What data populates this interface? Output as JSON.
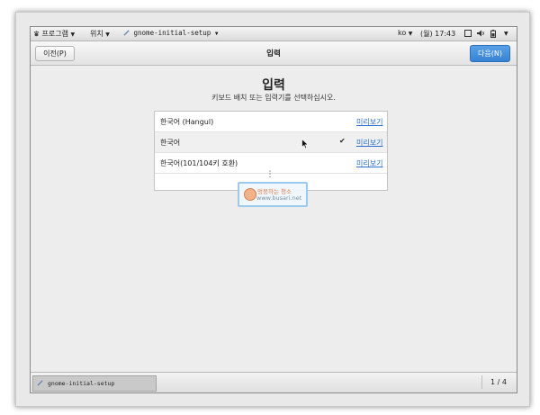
{
  "top_panel": {
    "applications": "프로그램",
    "places": "위치",
    "app_name": "gnome-initial-setup",
    "keyboard_layout": "ko",
    "datetime": "(월) 17:43"
  },
  "header": {
    "prev_label": "이전(P)",
    "title": "입력",
    "next_label": "다음(N)"
  },
  "main": {
    "title": "입력",
    "subtitle": "키보드 배치 또는 입력기를 선택하십시오.",
    "items": [
      {
        "name": "한국어 (Hangul)",
        "preview": "미리보기",
        "selected": false
      },
      {
        "name": "한국어",
        "preview": "미리보기",
        "selected": true,
        "check": "✔"
      },
      {
        "name": "한국어(101/104키 호환)",
        "preview": "미리보기",
        "selected": false
      }
    ],
    "more_icon": "⋮"
  },
  "watermark": {
    "line1": "멍뭉하는 청소",
    "line2": "www.busari.net"
  },
  "bottom_panel": {
    "task_label": "gnome-initial-setup",
    "workspace": "1 / 4"
  },
  "colors": {
    "accent": "#3783d3",
    "link": "#2a6fcf"
  }
}
